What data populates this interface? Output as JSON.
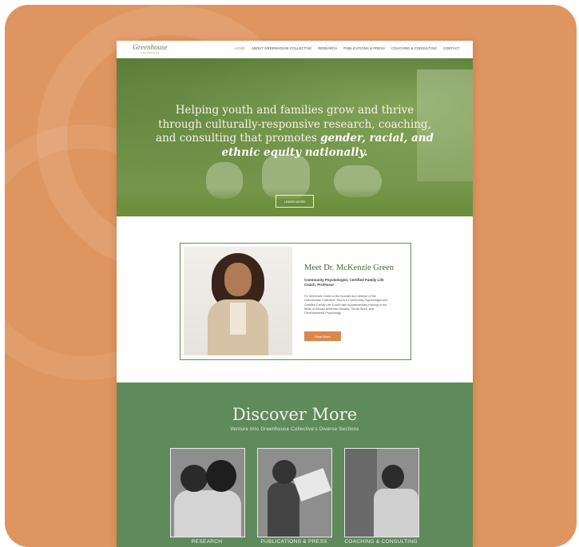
{
  "nav": {
    "logo": "Greenhouse",
    "logo_sub": "COLLECTIVE",
    "items": [
      "HOME",
      "ABOUT GREENHOUSE COLLECTIVE",
      "RESEARCH",
      "PUBLICATIONS & PRESS",
      "COACHING & CONSULTING",
      "CONTACT"
    ]
  },
  "hero": {
    "line1": "Helping youth and families grow and thrive",
    "line2": "through culturally-responsive research, coaching,",
    "line3": "and consulting that promotes",
    "emphasis1": "gender, racial, and",
    "emphasis2": "ethnic equity nationally.",
    "button": "LEARN MORE"
  },
  "meet": {
    "title": "Meet Dr. McKenzie Green",
    "subtitle": "Community Psychologist, Certified Family Life Coach, Professor",
    "body": "Dr. McKenzie Green is the founder and director of the Greenhouse Collective. She is a Community Psychologist and Certified Family Life Coach with supplementary training in the fields of African American Studies, Social Work, and Developmental Psychology.",
    "button": "Read More"
  },
  "discover": {
    "title": "Discover More",
    "subtitle": "Venture Into Greenhouse Collective's Diverse Sections",
    "tiles": [
      "RESEARCH",
      "PUBLICATIONS & PRESS",
      "COACHING & CONSULTING"
    ]
  },
  "colors": {
    "frame": "#df955f",
    "hero_green": "#5f8540",
    "discover_green": "#5f8a5c",
    "accent_orange": "#d9874c"
  }
}
